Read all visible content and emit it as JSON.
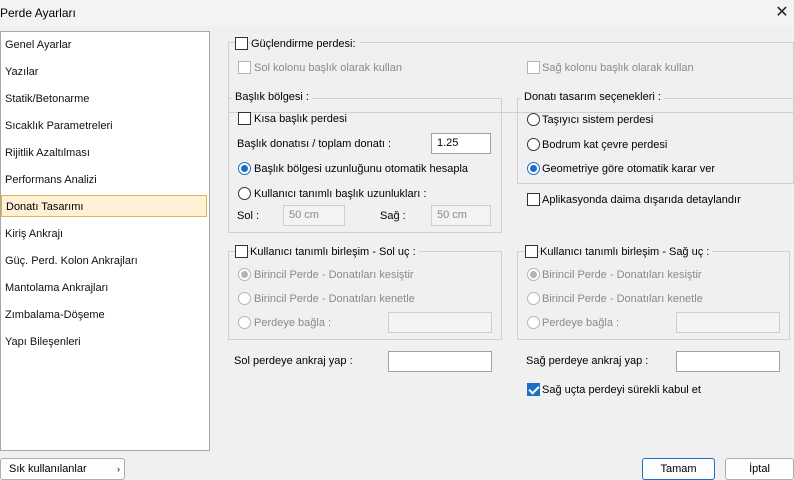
{
  "window": {
    "title": "Perde Ayarları"
  },
  "sidebar": {
    "items": [
      {
        "label": "Genel Ayarlar"
      },
      {
        "label": "Yazılar"
      },
      {
        "label": "Statik/Betonarme"
      },
      {
        "label": "Sıcaklık Parametreleri"
      },
      {
        "label": "Rijitlik Azaltılması"
      },
      {
        "label": "Performans Analizi"
      },
      {
        "label": "Donatı Tasarımı"
      },
      {
        "label": "Kiriş Ankrajı"
      },
      {
        "label": "Güç. Perd. Kolon Ankrajları"
      },
      {
        "label": "Mantolama Ankrajları"
      },
      {
        "label": "Zımbalama-Döşeme"
      },
      {
        "label": "Yapı Bileşenleri"
      }
    ],
    "selected": "Donatı Tasarımı"
  },
  "reinforcement": {
    "enabled_label": "Güçlendirme perdesi:",
    "left_col_header": "Sol kolonu başlık olarak kullan",
    "right_col_header": "Sağ kolonu başlık olarak kullan"
  },
  "header_zone": {
    "title": "Başlık bölgesi :",
    "short_header": "Kısa başlık perdesi",
    "ratio_label": "Başlık donatısı / toplam donatı :",
    "ratio_value": "1.25",
    "auto_length": "Başlık bölgesi uzunluğunu otomatik hesapla",
    "user_length": "Kullanıcı tanımlı başlık uzunlukları :",
    "left_label": "Sol :",
    "left_value": "50 cm",
    "right_label": "Sağ :",
    "right_value": "50 cm"
  },
  "design_options": {
    "title": "Donatı tasarım seçenekleri :",
    "opt1": "Taşıyıcı sistem perdesi",
    "opt2": "Bodrum kat çevre perdesi",
    "opt3": "Geometriye göre otomatik karar ver",
    "selected": "Geometriye göre otomatik karar ver",
    "detail_label": "Aplikasyonda daima dışarıda detaylandır"
  },
  "left_joint": {
    "title": "Kullanıcı tanımlı birleşim - Sol uç :",
    "opt1": "Birincil Perde - Donatıları kesiştir",
    "opt2": "Birincil Perde - Donatıları kenetle",
    "opt3": "Perdeye bağla :"
  },
  "right_joint": {
    "title": "Kullanıcı tanımlı birleşim - Sağ uç :",
    "opt1": "Birincil Perde - Donatıları kesiştir",
    "opt2": "Birincil Perde - Donatıları kenetle",
    "opt3": "Perdeye bağla :"
  },
  "anchorage": {
    "left_label": "Sol perdeye ankraj yap :",
    "right_label": "Sağ perdeye ankraj yap :",
    "continuous_label": "Sağ uçta perdeyi sürekli kabul et",
    "continuous_checked": true
  },
  "footer": {
    "favorites": "Sık kullanılanlar",
    "ok": "Tamam",
    "cancel": "İptal"
  },
  "colors": {
    "accent": "#1a6fc6",
    "selection_bg": "#fff1d6",
    "selection_border": "#e4b250"
  }
}
